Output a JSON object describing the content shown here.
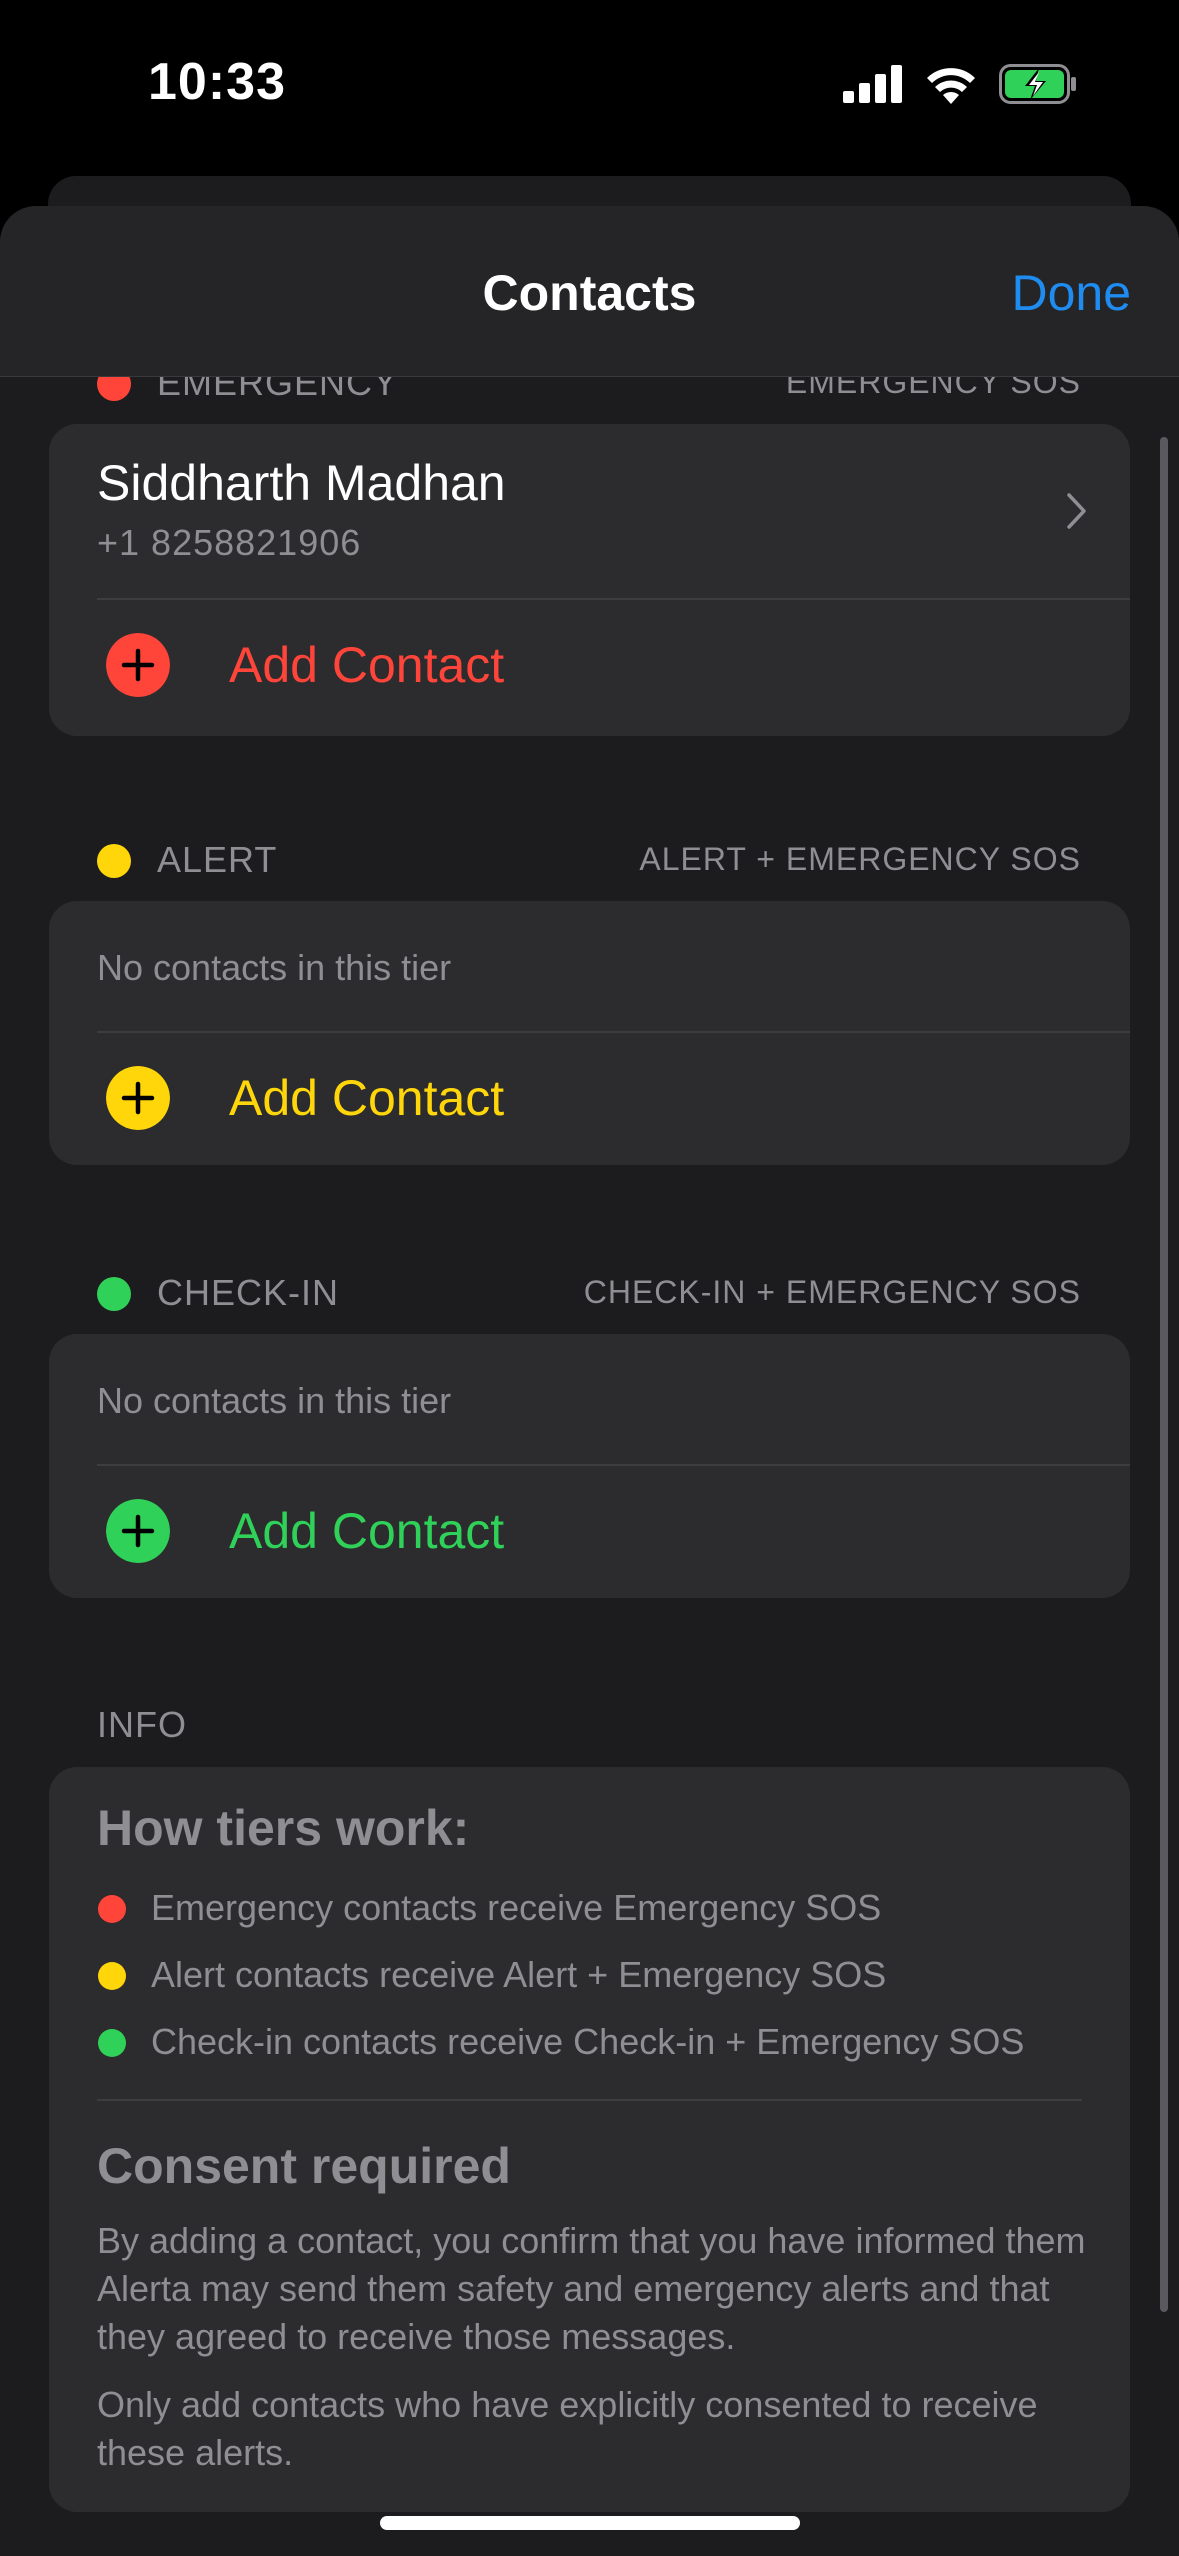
{
  "status_bar": {
    "time": "10:33",
    "battery_color": "#30d158",
    "signal_icon": "cellular-signal-icon",
    "wifi_icon": "wifi-icon",
    "battery_icon": "battery-charging-icon"
  },
  "nav": {
    "title": "Contacts",
    "done_label": "Done"
  },
  "colors": {
    "red": "#ff453a",
    "yellow": "#ffd60a",
    "green": "#30d158",
    "accent": "#1e8cf0"
  },
  "emergency": {
    "label": "EMERGENCY",
    "scope": "EMERGENCY SOS",
    "contacts": [
      {
        "name": "Siddharth Madhan",
        "phone": "+1 8258821906"
      }
    ],
    "add_label": "Add Contact"
  },
  "alert": {
    "label": "ALERT",
    "scope": "ALERT + EMERGENCY SOS",
    "empty_text": "No contacts in this tier",
    "add_label": "Add Contact"
  },
  "checkin": {
    "label": "CHECK-IN",
    "scope": "CHECK-IN + EMERGENCY SOS",
    "empty_text": "No contacts in this tier",
    "add_label": "Add Contact"
  },
  "info": {
    "header": "INFO",
    "how_title": "How tiers work:",
    "bullets": [
      "Emergency contacts receive Emergency SOS",
      "Alert contacts receive Alert + Emergency SOS",
      "Check-in contacts receive Check-in + Emergency SOS"
    ],
    "consent_title": "Consent required",
    "consent_text": "By adding a contact, you confirm that you have informed them Alerta may send them safety and emergency alerts and that they agreed to receive those messages.",
    "consent_note": "Only add contacts who have explicitly consented to receive these alerts."
  }
}
